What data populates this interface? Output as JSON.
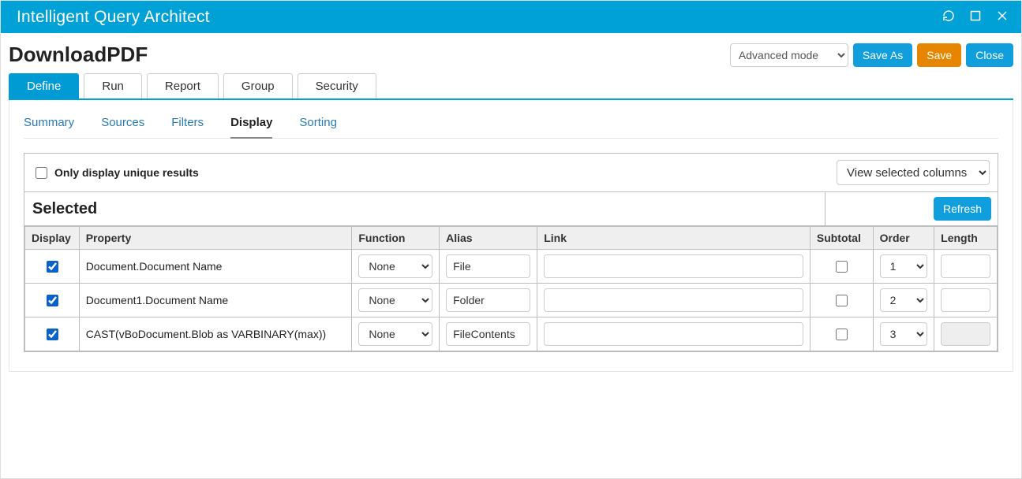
{
  "window": {
    "title": "Intelligent Query Architect"
  },
  "page": {
    "title": "DownloadPDF"
  },
  "mode_options": [
    "Advanced mode"
  ],
  "mode_selected": "Advanced mode",
  "header_buttons": {
    "save_as": "Save As",
    "save": "Save",
    "close": "Close"
  },
  "main_tabs": [
    "Define",
    "Run",
    "Report",
    "Group",
    "Security"
  ],
  "main_tab_active": "Define",
  "sub_tabs": [
    "Summary",
    "Sources",
    "Filters",
    "Display",
    "Sorting"
  ],
  "sub_tab_active": "Display",
  "display_panel": {
    "unique_label": "Only display unique results",
    "view_options": [
      "View selected columns"
    ],
    "view_selected": "View selected columns",
    "selected_title": "Selected",
    "refresh": "Refresh",
    "columns": {
      "display": "Display",
      "property": "Property",
      "function": "Function",
      "alias": "Alias",
      "link": "Link",
      "subtotal": "Subtotal",
      "order": "Order",
      "length": "Length"
    },
    "function_options": [
      "None"
    ],
    "order_options": [
      "1",
      "2",
      "3"
    ],
    "rows": [
      {
        "display": true,
        "property": "Document.Document Name",
        "function": "None",
        "alias": "File",
        "link": "",
        "subtotal": false,
        "order": "1",
        "length": "",
        "length_disabled": false
      },
      {
        "display": true,
        "property": "Document1.Document Name",
        "function": "None",
        "alias": "Folder",
        "link": "",
        "subtotal": false,
        "order": "2",
        "length": "",
        "length_disabled": false
      },
      {
        "display": true,
        "property": "CAST(vBoDocument.Blob as VARBINARY(max))",
        "function": "None",
        "alias": "FileContents",
        "link": "",
        "subtotal": false,
        "order": "3",
        "length": "",
        "length_disabled": true
      }
    ]
  }
}
